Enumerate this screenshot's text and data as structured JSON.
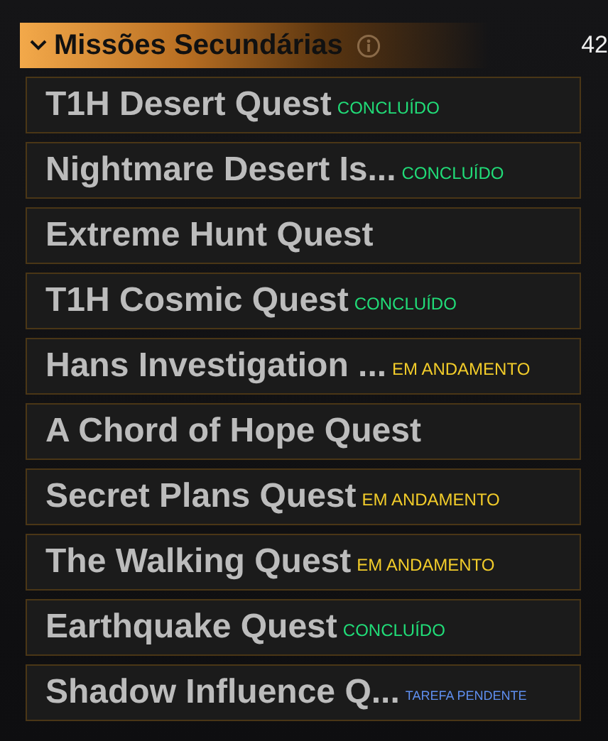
{
  "section": {
    "title": "Missões Secundárias",
    "expanded": true,
    "count": "42"
  },
  "quests": [
    {
      "name": "T1H Desert Quest",
      "status": {
        "kind": "done",
        "label": "CONCLUÍDO"
      }
    },
    {
      "name": "Nightmare Desert Is...",
      "status": {
        "kind": "done",
        "label": "CONCLUÍDO"
      }
    },
    {
      "name": "Extreme Hunt Quest"
    },
    {
      "name": "T1H Cosmic Quest",
      "status": {
        "kind": "done",
        "label": "CONCLUÍDO"
      }
    },
    {
      "name": "Hans Investigation ...",
      "status": {
        "kind": "progress",
        "label": "EM ANDAMENTO"
      }
    },
    {
      "name": "A Chord of Hope Quest"
    },
    {
      "name": "Secret Plans Quest",
      "status": {
        "kind": "progress",
        "label": "EM ANDAMENTO"
      }
    },
    {
      "name": "The Walking Quest",
      "status": {
        "kind": "progress",
        "label": "EM ANDAMENTO"
      }
    },
    {
      "name": "Earthquake Quest",
      "status": {
        "kind": "done",
        "label": "CONCLUÍDO"
      }
    },
    {
      "name": "Shadow Influence Q...",
      "status": {
        "kind": "pending",
        "label": "TAREFA PENDENTE"
      }
    }
  ]
}
